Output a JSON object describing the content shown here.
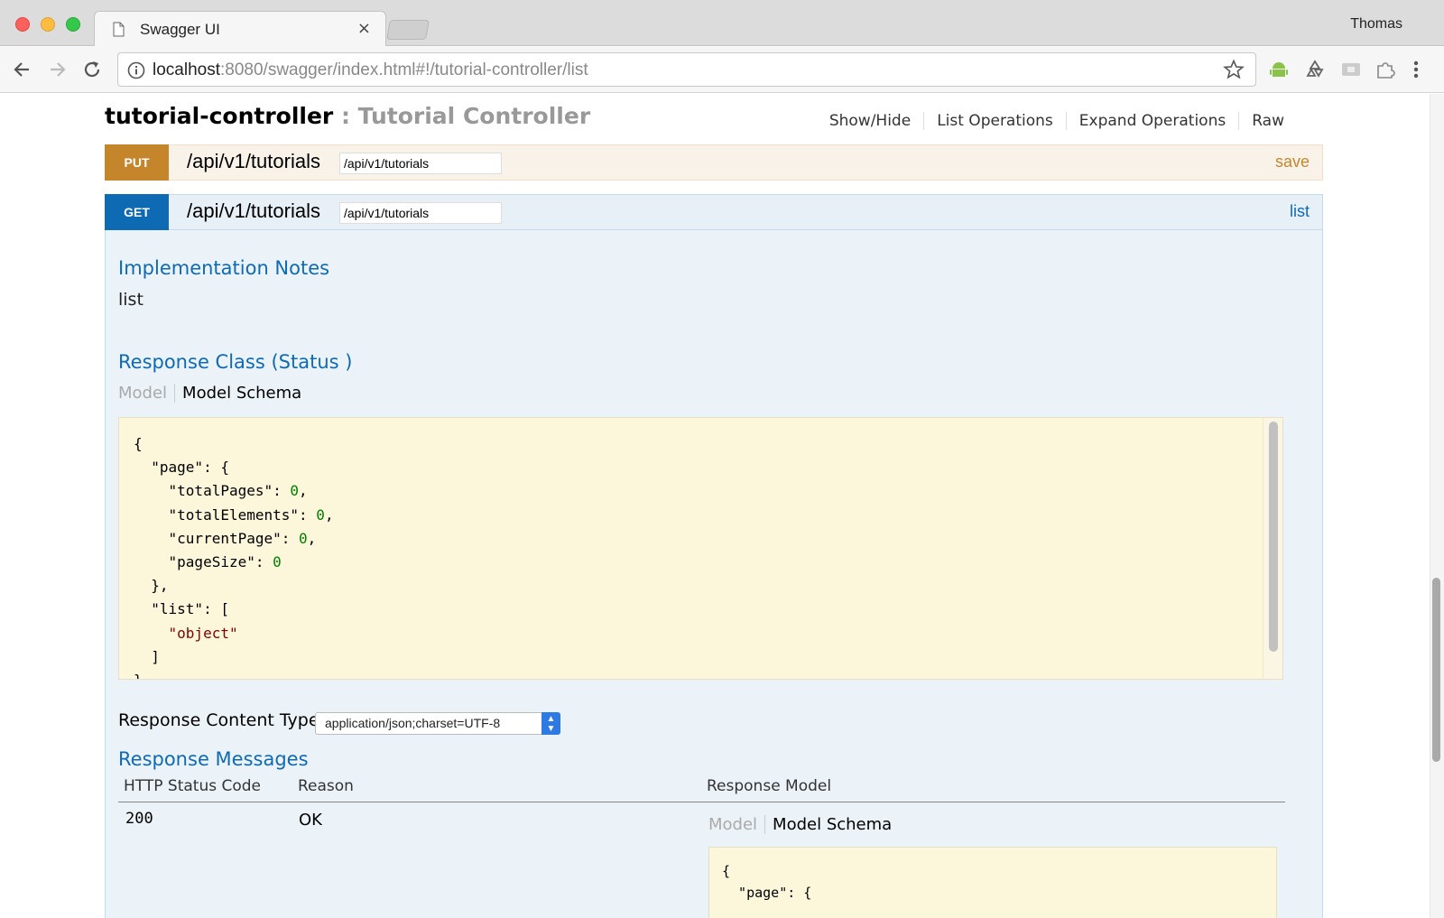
{
  "browser": {
    "tab_title": "Swagger UI",
    "tab_close": "×",
    "profile_name": "Thomas",
    "url_host": "localhost",
    "url_rest": ":8080/swagger/index.html#!/tutorial-controller/list"
  },
  "controller": {
    "name": "tutorial-controller",
    "separator": " : ",
    "description": "Tutorial Controller",
    "links": [
      "Show/Hide",
      "List Operations",
      "Expand Operations",
      "Raw"
    ]
  },
  "operations": {
    "put": {
      "method": "PUT",
      "path": "/api/v1/tutorials",
      "input_value": "/api/v1/tutorials",
      "summary": "save"
    },
    "get": {
      "method": "GET",
      "path": "/api/v1/tutorials",
      "input_value": "/api/v1/tutorials",
      "summary": "list"
    }
  },
  "get_details": {
    "impl_notes_title": "Implementation Notes",
    "impl_notes_text": "list",
    "response_class_title": "Response Class (Status )",
    "model_tab": "Model",
    "model_schema_tab": "Model Schema",
    "response_content_type_label": "Response Content Type",
    "response_content_type_value": "application/json;charset=UTF-8",
    "response_messages_title": "Response Messages",
    "table_headers": [
      "HTTP Status Code",
      "Reason",
      "Response Model"
    ],
    "rows": [
      {
        "status": "200",
        "reason": "OK",
        "model_tab": "Model",
        "model_schema_tab": "Model Schema"
      }
    ]
  },
  "colors": {
    "put": "#c5862b",
    "get": "#0f6ab4",
    "get_background": "#ebf3f9",
    "code_background": "#fcf6db"
  },
  "icons": [
    "file-icon",
    "back-arrow-icon",
    "forward-arrow-icon",
    "reload-icon",
    "info-icon",
    "star-icon",
    "android-icon",
    "recycle-icon",
    "cast-icon",
    "puzzle-icon",
    "menu-dots-icon"
  ]
}
